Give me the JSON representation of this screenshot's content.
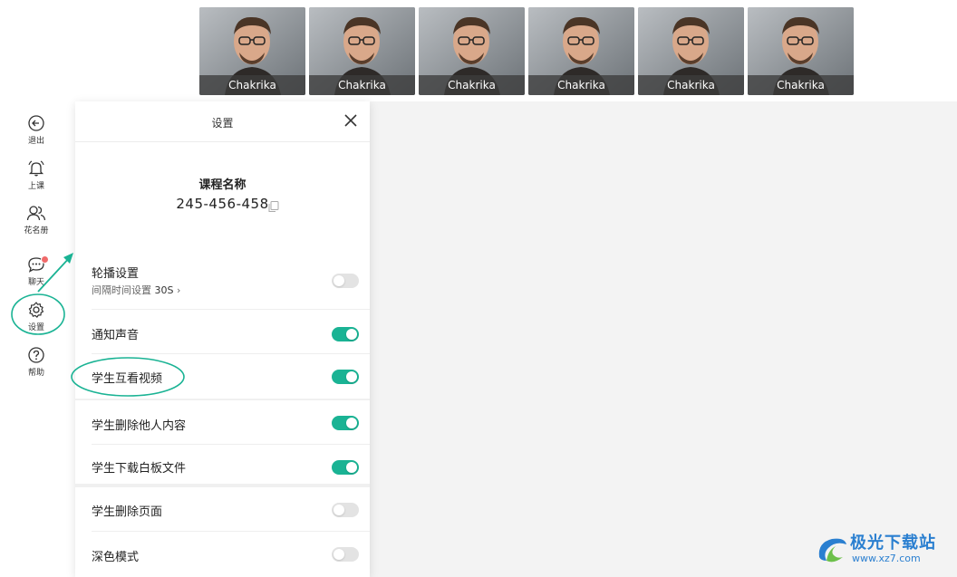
{
  "video_tiles": [
    {
      "name": "Chakrika"
    },
    {
      "name": "Chakrika"
    },
    {
      "name": "Chakrika"
    },
    {
      "name": "Chakrika"
    },
    {
      "name": "Chakrika"
    },
    {
      "name": "Chakrika"
    }
  ],
  "toolbar": {
    "exit": "退出",
    "class": "上课",
    "roster": "花名册",
    "chat": "聊天",
    "settings": "设置",
    "help": "帮助"
  },
  "panel": {
    "title": "设置",
    "course_name": "课程名称",
    "course_id": "245-456-458",
    "rows": {
      "carousel": {
        "label": "轮播设置",
        "sub_label": "间隔时间设置",
        "sub_value": "30S",
        "on": false
      },
      "notify_sound": {
        "label": "通知声音",
        "on": true
      },
      "student_mutual_view": {
        "label": "学生互看视频",
        "on": true
      },
      "student_delete_others": {
        "label": "学生删除他人内容",
        "on": true
      },
      "student_download_whiteboard": {
        "label": "学生下载白板文件",
        "on": true
      },
      "student_delete_page": {
        "label": "学生删除页面",
        "on": false
      },
      "dark_mode": {
        "label": "深色模式",
        "on": false
      }
    }
  },
  "watermark": {
    "text": "极光下载站",
    "url": "www.xz7.com"
  },
  "colors": {
    "accent": "#1ab394",
    "badge": "#f06a6a",
    "toggle_off": "#e3e3e3"
  },
  "icons": [
    "exit-icon",
    "bell-icon",
    "people-icon",
    "chat-icon",
    "gear-icon",
    "help-icon",
    "close-icon",
    "copy-icon"
  ]
}
